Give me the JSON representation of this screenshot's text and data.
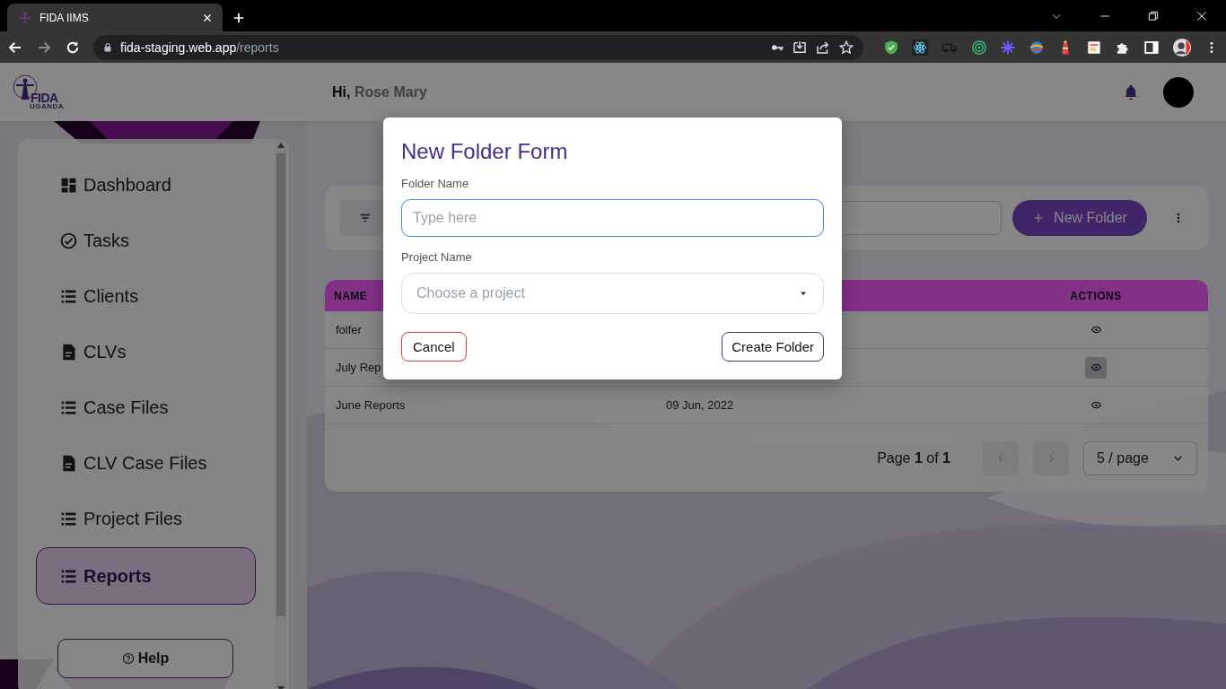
{
  "browser": {
    "tab_title": "FIDA IIMS",
    "url_host": "fida-staging.web.app",
    "url_path": "/reports"
  },
  "header": {
    "logo_text": "FIDA",
    "logo_subtext": "UGANDA",
    "greeting": "Hi,",
    "user_name": "Rose Mary"
  },
  "sidebar": {
    "items": [
      {
        "label": "Dashboard",
        "kind": "dashboard",
        "selected": false
      },
      {
        "label": "Tasks",
        "kind": "check",
        "selected": false
      },
      {
        "label": "Clients",
        "kind": "list",
        "selected": false
      },
      {
        "label": "CLVs",
        "kind": "doc",
        "selected": false
      },
      {
        "label": "Case Files",
        "kind": "list",
        "selected": false
      },
      {
        "label": "CLV Case Files",
        "kind": "doc",
        "selected": false
      },
      {
        "label": "Project Files",
        "kind": "list",
        "selected": false
      },
      {
        "label": "Reports",
        "kind": "list",
        "selected": true
      }
    ],
    "help": "Help"
  },
  "toolbar": {
    "new_folder": "New Folder"
  },
  "table": {
    "columns": [
      "NAME",
      "ACTIONS"
    ],
    "rows": [
      {
        "name": "folfer",
        "hovered": false
      },
      {
        "name": "July Rep",
        "hovered": true
      },
      {
        "name": "June Reports",
        "column_2": "09 Jun, 2022",
        "hovered": false
      }
    ]
  },
  "pagination": {
    "page_label": "Page **1** of **1**",
    "page_size": "5 / page"
  },
  "modal": {
    "title": "New Folder Form",
    "folder_label": "Folder Name",
    "folder_placeholder": "Type here",
    "project_label": "Project Name",
    "project_placeholder": "Choose a project",
    "cancel": "Cancel",
    "submit": "Create Folder"
  }
}
